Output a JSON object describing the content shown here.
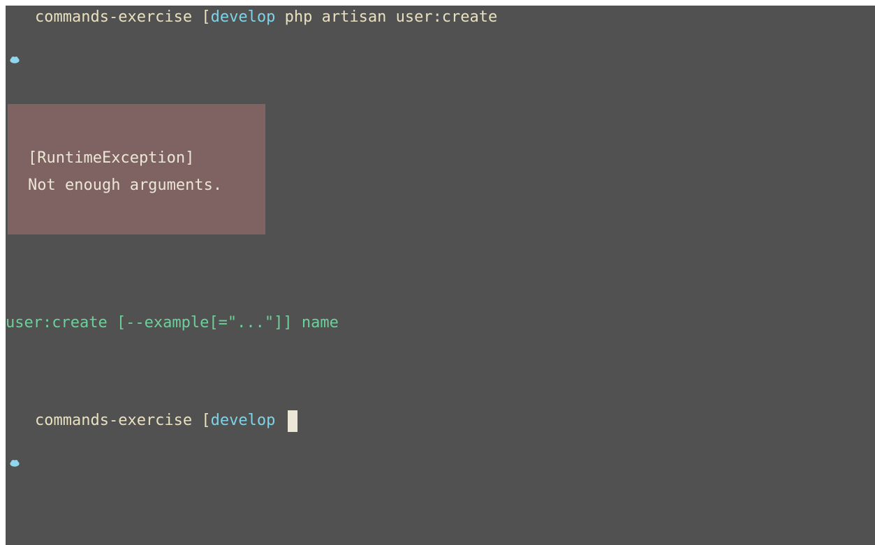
{
  "terminal": {
    "background": "#515151",
    "prompt_icon": "cloud-icon",
    "line1": {
      "directory": "commands-exercise",
      "bracket": "[",
      "branch": "develop",
      "command": "php artisan user:create"
    },
    "error": {
      "background": "#7f6262",
      "type": "[RuntimeException]",
      "message": "Not enough arguments."
    },
    "usage": "user:create [--example[=\"...\"]] name",
    "prompt2": {
      "directory": "commands-exercise",
      "bracket": "[",
      "branch": "develop"
    }
  }
}
